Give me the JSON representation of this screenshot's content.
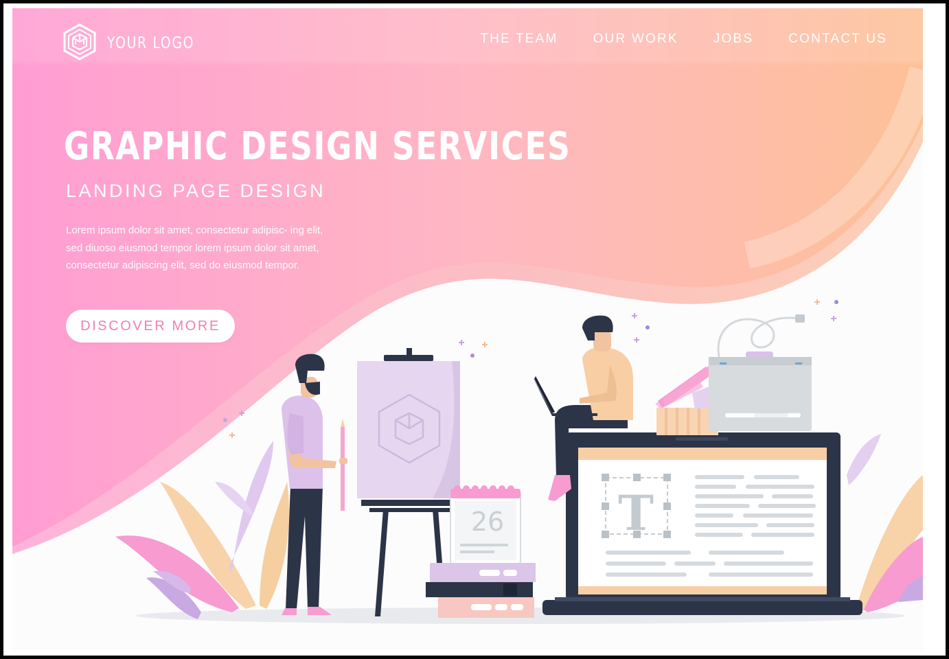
{
  "brand": {
    "logo_text": "YOUR LOGO",
    "logo_icon": "hexagon-cube-logo-icon"
  },
  "nav": {
    "items": [
      {
        "label": "THE TEAM"
      },
      {
        "label": "OUR WORK"
      },
      {
        "label": "JOBS"
      },
      {
        "label": "CONTACT US"
      }
    ]
  },
  "hero": {
    "headline": "GRAPHIC DESIGN SERVICES",
    "subheadline": "LANDING PAGE DESIGN",
    "body": "Lorem ipsum dolor sit amet, consectetur adipisc- ing elit, sed diuoso eiusmod tempor lorem ipsum dolor sit amet, consectetur adipiscing elit, sed do eiusmod tempor.",
    "cta_label": "DISCOVER MORE"
  },
  "illustration": {
    "calendar_day": "26",
    "text_tool_glyph": "T",
    "icons": [
      "easel-icon",
      "calendar-icon",
      "laptop-icon",
      "color-swatch-icon",
      "graphics-tablet-icon",
      "pencil-icon",
      "leaf-icon"
    ]
  },
  "colors": {
    "gradient_start": "#ff9dd0",
    "gradient_mid": "#ffb6c4",
    "gradient_end": "#fdc39a",
    "accent_pink": "#ef7fb2",
    "dark_navy": "#2c3448",
    "lavender": "#e3d3ec",
    "peach": "#f7cfa4"
  }
}
